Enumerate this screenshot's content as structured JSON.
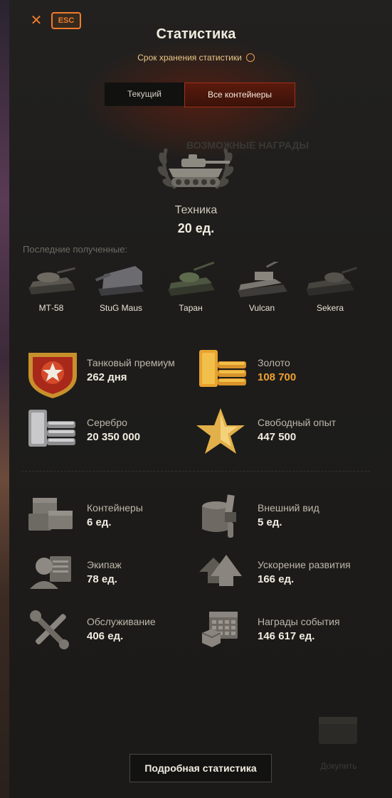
{
  "header": {
    "close_icon": "close-icon",
    "esc_label": "ESC",
    "title": "Статистика",
    "subtitle": "Срок хранения статистики",
    "subtitle_icon": "clock-icon"
  },
  "tabs": [
    {
      "label": "Текущий",
      "active": false
    },
    {
      "label": "Все контейнеры",
      "active": true
    }
  ],
  "background_ghost": {
    "rewards_label": "ВОЗМОЖНЫЕ НАГРАДЫ"
  },
  "vehicles": {
    "icon": "tank-laurel-icon",
    "label": "Техника",
    "value": "20 ед."
  },
  "recent": {
    "label": "Последние полученные:",
    "tanks": [
      "МТ-58",
      "StuG Maus",
      "Таран",
      "Vulcan",
      "Sekera"
    ]
  },
  "resources": [
    {
      "icon": "tank-premium-icon",
      "label": "Танковый премиум",
      "value": "262 дня",
      "accent": false
    },
    {
      "icon": "gold-icon",
      "label": "Золото",
      "value": "108 700",
      "accent": true
    },
    {
      "icon": "silver-icon",
      "label": "Серебро",
      "value": "20 350 000",
      "accent": false
    },
    {
      "icon": "free-xp-icon",
      "label": "Свободный опыт",
      "value": "447 500",
      "accent": false
    }
  ],
  "other": [
    {
      "icon": "containers-icon",
      "label": "Контейнеры",
      "value": "6 ед."
    },
    {
      "icon": "customization-icon",
      "label": "Внешний вид",
      "value": "5 ед."
    },
    {
      "icon": "crew-icon",
      "label": "Экипаж",
      "value": "78 ед."
    },
    {
      "icon": "boost-icon",
      "label": "Ускорение развития",
      "value": "166 ед."
    },
    {
      "icon": "maintenance-icon",
      "label": "Обслуживание",
      "value": "406 ед."
    },
    {
      "icon": "event-rewards-icon",
      "label": "Награды события",
      "value": "146 617 ед."
    }
  ],
  "footer": {
    "details_button": "Подробная статистика",
    "buy_label": "Докупить"
  },
  "colors": {
    "accent": "#f07b2c",
    "gold_value": "#f0a030",
    "active_tab": "#a0311a"
  }
}
